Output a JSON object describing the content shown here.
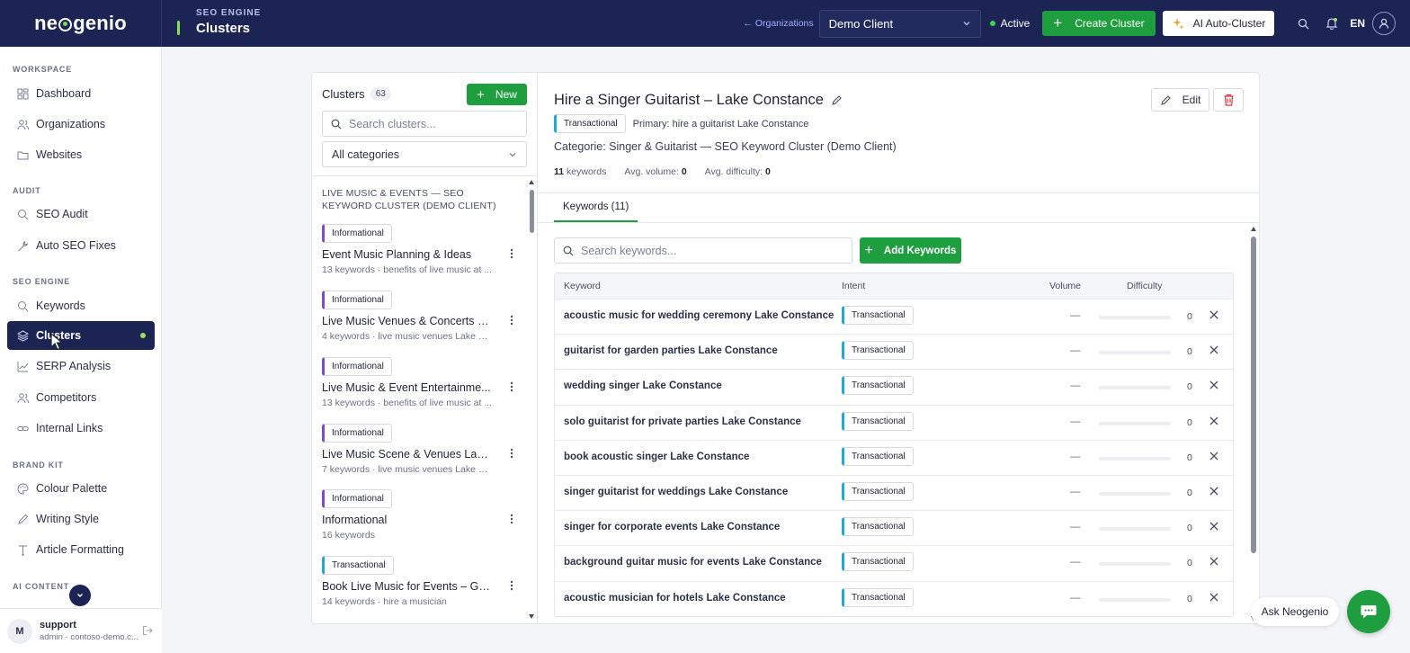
{
  "brand": {
    "name_prefix": "ne",
    "name_suffix": "genio"
  },
  "header": {
    "eyebrow": "SEO ENGINE",
    "title": "Clusters",
    "org_link": "← Organizations",
    "client": "Demo Client",
    "status": "Active",
    "create_label": "Create Cluster",
    "auto_label": "AI Auto-Cluster",
    "lang": "EN"
  },
  "sidebar": {
    "sections": [
      {
        "label": "WORKSPACE"
      },
      {
        "label": "AUDIT"
      },
      {
        "label": "SEO ENGINE"
      },
      {
        "label": "BRAND KIT"
      },
      {
        "label": "AI CONTENT"
      }
    ],
    "items": [
      {
        "label": "Dashboard",
        "icon": "dashboard-icon"
      },
      {
        "label": "Organizations",
        "icon": "users-icon"
      },
      {
        "label": "Websites",
        "icon": "folder-icon"
      },
      {
        "label": "SEO Audit",
        "icon": "audit-icon"
      },
      {
        "label": "Auto SEO Fixes",
        "icon": "wrench-icon"
      },
      {
        "label": "Keywords",
        "icon": "search-icon"
      },
      {
        "label": "Clusters",
        "icon": "layers-icon",
        "active": true
      },
      {
        "label": "SERP Analysis",
        "icon": "chart-icon"
      },
      {
        "label": "Competitors",
        "icon": "users-icon"
      },
      {
        "label": "Internal Links",
        "icon": "link-icon"
      },
      {
        "label": "Colour Palette",
        "icon": "palette-icon"
      },
      {
        "label": "Writing Style",
        "icon": "pen-icon"
      },
      {
        "label": "Article Formatting",
        "icon": "text-icon"
      }
    ],
    "user": {
      "initial": "M",
      "name": "support",
      "sub": "admin · contoso-demo.c..."
    }
  },
  "clusters_panel": {
    "title": "Clusters",
    "count": "63",
    "new_label": "New",
    "search_placeholder": "Search clusters...",
    "category_filter": "All categories",
    "group_label": "LIVE MUSIC & EVENTS — SEO KEYWORD CLUSTER (DEMO CLIENT)",
    "items": [
      {
        "intent": "Informational",
        "title": "Event Music Planning & Ideas",
        "meta": "13 keywords · benefits of live music at ..."
      },
      {
        "intent": "Informational",
        "title": "Live Music Venues & Concerts – ...",
        "meta": "4 keywords · live music venues Lake Co..."
      },
      {
        "intent": "Informational",
        "title": "Live Music & Event Entertainme...",
        "meta": "13 keywords · benefits of live music at ..."
      },
      {
        "intent": "Informational",
        "title": "Live Music Scene & Venues Lake...",
        "meta": "7 keywords · live music venues Lake Co..."
      },
      {
        "intent": "Informational",
        "title": "Informational",
        "meta": "16 keywords"
      },
      {
        "intent": "Transactional",
        "title": "Book Live Music for Events – Ge...",
        "meta": "14 keywords · hire a musician"
      }
    ]
  },
  "detail": {
    "title": "Hire a Singer Guitarist – Lake Constance",
    "intent": "Transactional",
    "primary": "Primary: hire a guitarist Lake Constance",
    "category": "Categorie: Singer & Guitarist — SEO Keyword Cluster (Demo Client)",
    "stats": {
      "keywords_num": "11",
      "keywords_label": "keywords",
      "volume_label": "Avg. volume:",
      "volume": "0",
      "difficulty_label": "Avg. difficulty:",
      "difficulty": "0"
    },
    "edit_label": "Edit",
    "tab_label": "Keywords (11)",
    "search_placeholder": "Search keywords...",
    "add_label": "Add Keywords",
    "columns": {
      "keyword": "Keyword",
      "intent": "Intent",
      "volume": "Volume",
      "difficulty": "Difficulty"
    },
    "rows": [
      {
        "keyword": "acoustic music for wedding ceremony Lake Constance",
        "intent": "Transactional",
        "volume": "—",
        "difficulty": "0"
      },
      {
        "keyword": "guitarist for garden parties Lake Constance",
        "intent": "Transactional",
        "volume": "—",
        "difficulty": "0"
      },
      {
        "keyword": "wedding singer Lake Constance",
        "intent": "Transactional",
        "volume": "—",
        "difficulty": "0"
      },
      {
        "keyword": "solo guitarist for private parties Lake Constance",
        "intent": "Transactional",
        "volume": "—",
        "difficulty": "0"
      },
      {
        "keyword": "book acoustic singer Lake Constance",
        "intent": "Transactional",
        "volume": "—",
        "difficulty": "0"
      },
      {
        "keyword": "singer guitarist for weddings Lake Constance",
        "intent": "Transactional",
        "volume": "—",
        "difficulty": "0"
      },
      {
        "keyword": "singer for corporate events Lake Constance",
        "intent": "Transactional",
        "volume": "—",
        "difficulty": "0"
      },
      {
        "keyword": "background guitar music for events Lake Constance",
        "intent": "Transactional",
        "volume": "—",
        "difficulty": "0"
      },
      {
        "keyword": "acoustic musician for hotels Lake Constance",
        "intent": "Transactional",
        "volume": "—",
        "difficulty": "0"
      }
    ]
  },
  "assistant": {
    "label": "Ask Neogenio"
  },
  "colors": {
    "navy": "#1c2454",
    "green": "#1e9e3e",
    "accent_lime": "#8be04e",
    "informational": "#7b4bd6",
    "transactional": "#22a7d6",
    "delete": "#d9363e"
  }
}
